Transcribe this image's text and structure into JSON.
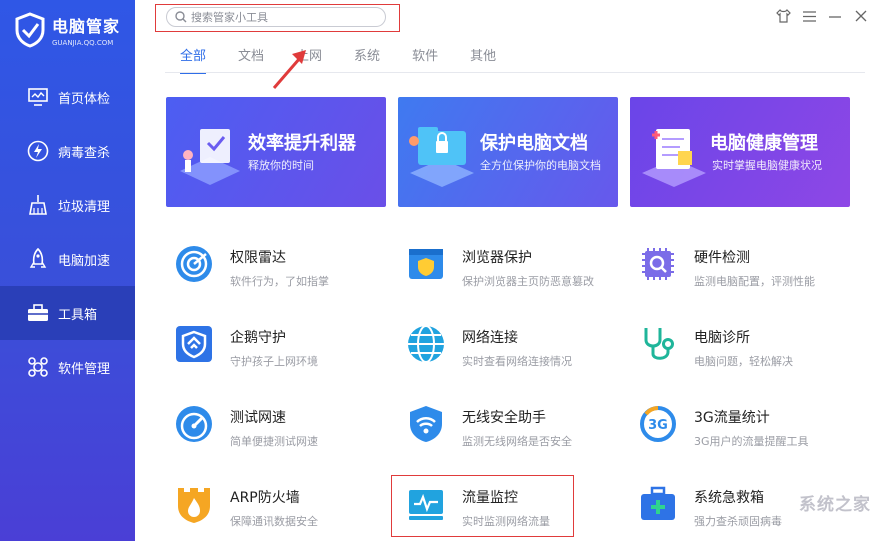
{
  "app": {
    "name": "电脑管家",
    "subtitle": "GUANJIA.QQ.COM"
  },
  "sidebar": {
    "items": [
      {
        "label": "首页体检",
        "icon": "monitor-icon"
      },
      {
        "label": "病毒查杀",
        "icon": "lightning-icon"
      },
      {
        "label": "垃圾清理",
        "icon": "broom-icon"
      },
      {
        "label": "电脑加速",
        "icon": "rocket-icon"
      },
      {
        "label": "工具箱",
        "icon": "toolbox-icon",
        "active": true
      },
      {
        "label": "软件管理",
        "icon": "apps-icon"
      }
    ]
  },
  "search": {
    "placeholder": "搜索管家小工具"
  },
  "tabs": [
    {
      "label": "全部",
      "active": true
    },
    {
      "label": "文档"
    },
    {
      "label": "上网"
    },
    {
      "label": "系统"
    },
    {
      "label": "软件"
    },
    {
      "label": "其他"
    }
  ],
  "banners": [
    {
      "title": "效率提升利器",
      "subtitle": "释放你的时间"
    },
    {
      "title": "保护电脑文档",
      "subtitle": "全方位保护你的电脑文档"
    },
    {
      "title": "电脑健康管理",
      "subtitle": "实时掌握电脑健康状况"
    }
  ],
  "tools": [
    {
      "name": "权限雷达",
      "desc": "软件行为，了如指掌",
      "icon": "radar-icon"
    },
    {
      "name": "浏览器保护",
      "desc": "保护浏览器主页防恶意篡改",
      "icon": "browser-shield-icon"
    },
    {
      "name": "硬件检测",
      "desc": "监测电脑配置，评测性能",
      "icon": "chip-icon"
    },
    {
      "name": "企鹅守护",
      "desc": "守护孩子上网环境",
      "icon": "penguin-shield-icon"
    },
    {
      "name": "网络连接",
      "desc": "实时查看网络连接情况",
      "icon": "globe-icon"
    },
    {
      "name": "电脑诊所",
      "desc": "电脑问题，轻松解决",
      "icon": "stethoscope-icon"
    },
    {
      "name": "测试网速",
      "desc": "简单便捷测试网速",
      "icon": "speedometer-icon"
    },
    {
      "name": "无线安全助手",
      "desc": "监测无线网络是否安全",
      "icon": "wifi-shield-icon"
    },
    {
      "name": "3G流量统计",
      "desc": "3G用户的流量提醒工具",
      "icon": "3g-icon"
    },
    {
      "name": "ARP防火墙",
      "desc": "保障通讯数据安全",
      "icon": "firewall-icon"
    },
    {
      "name": "流量监控",
      "desc": "实时监测网络流量",
      "icon": "traffic-monitor-icon"
    },
    {
      "name": "系统急救箱",
      "desc": "强力查杀顽固病毒",
      "icon": "firstaid-icon"
    }
  ],
  "watermark": "系统之家"
}
